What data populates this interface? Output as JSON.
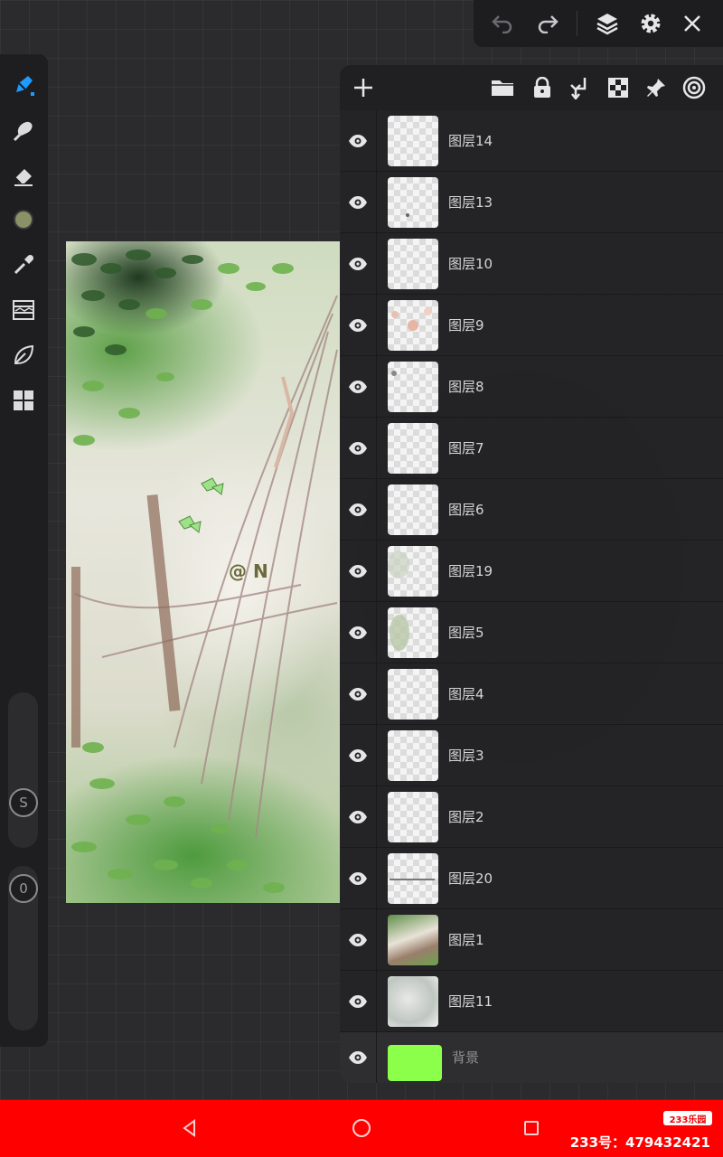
{
  "top_toolbar": {
    "icons": [
      "undo-icon",
      "redo-icon",
      "layers-icon",
      "settings-icon",
      "close-icon"
    ]
  },
  "left_tools": {
    "icons": [
      "brush-icon",
      "smudge-icon",
      "eraser-icon",
      "color-swatch",
      "eyedropper-icon",
      "adjust-icon",
      "leaf-icon",
      "gallery-icon"
    ],
    "active_color": "#8a9166",
    "accent": "#1e9bff",
    "size_slider_label": "S",
    "opacity_slider_label": "0"
  },
  "artwork": {
    "watermark": "@ N"
  },
  "layers_panel": {
    "toolbar_icons": [
      "add-icon",
      "folder-icon",
      "lock-icon",
      "merge-down-icon",
      "checker-icon",
      "pin-icon",
      "target-icon"
    ],
    "layers": [
      {
        "name": "图层14",
        "visible": true
      },
      {
        "name": "图层13",
        "visible": true
      },
      {
        "name": "图层10",
        "visible": true
      },
      {
        "name": "图层9",
        "visible": true
      },
      {
        "name": "图层8",
        "visible": true
      },
      {
        "name": "图层7",
        "visible": true
      },
      {
        "name": "图层6",
        "visible": true
      },
      {
        "name": "图层19",
        "visible": true
      },
      {
        "name": "图层5",
        "visible": true
      },
      {
        "name": "图层4",
        "visible": true
      },
      {
        "name": "图层3",
        "visible": true
      },
      {
        "name": "图层2",
        "visible": true
      },
      {
        "name": "图层20",
        "visible": true
      },
      {
        "name": "图层1",
        "visible": true
      },
      {
        "name": "图层11",
        "visible": true
      }
    ],
    "background_layer": {
      "name": "背景",
      "color": "#8cff4a"
    }
  },
  "bottom_bar": {
    "brand_label": "233乐园",
    "account_text": "233号：479432421",
    "background": "#ff0000"
  }
}
